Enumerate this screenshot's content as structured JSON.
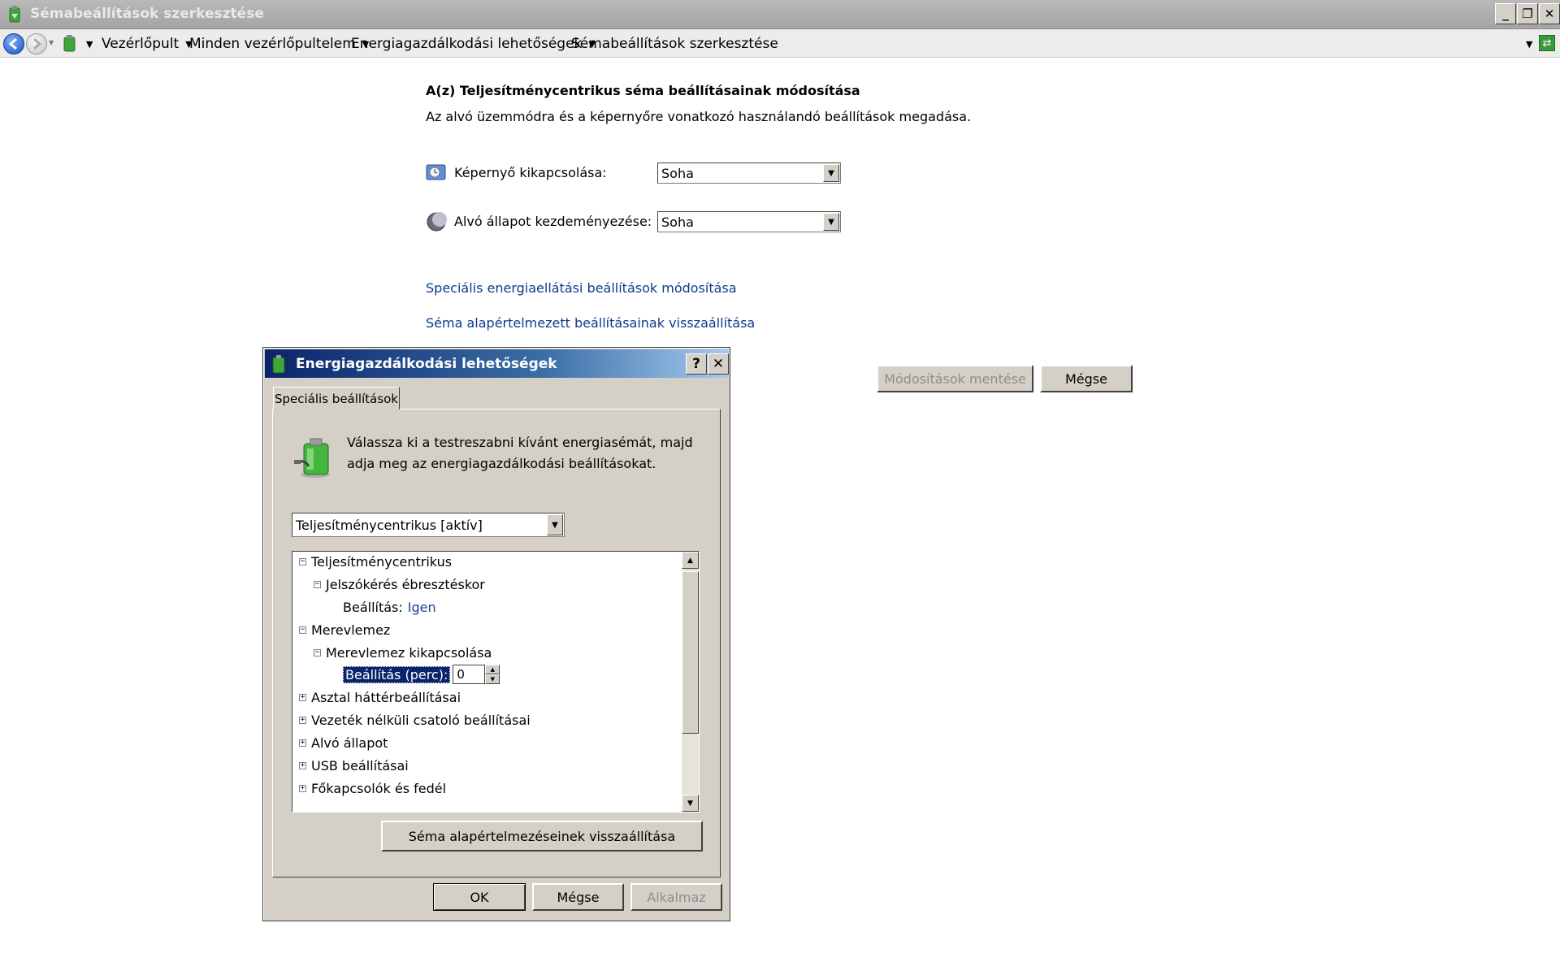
{
  "window": {
    "title": "Sémabeállítások szerkesztése",
    "minimize": "_",
    "restore": "❐",
    "close": "✕"
  },
  "address": {
    "crumbs": [
      "Vezérlőpult",
      "Minden vezérlőpultelem",
      "Energiagazdálkodási lehetőségek",
      "Sémabeállítások szerkesztése"
    ]
  },
  "main": {
    "heading": "A(z) Teljesítménycentrikus séma beállításainak módosítása",
    "subheading": "Az alvó üzemmódra és a képernyőre vonatkozó használandó beállítások megadása.",
    "display_off_label": "Képernyő kikapcsolása:",
    "display_off_value": "Soha",
    "sleep_label": "Alvó állapot kezdeményezése:",
    "sleep_value": "Soha",
    "advanced_link": "Speciális energiaellátási beállítások módosítása",
    "restore_link": "Séma alapértelmezett beállításainak visszaállítása",
    "save_button": "Módosítások mentése",
    "cancel_button": "Mégse"
  },
  "dialog": {
    "title": "Energiagazdálkodási lehetőségek",
    "help": "?",
    "close": "✕",
    "tab": "Speciális beállítások",
    "description": "Válassza ki a testreszabni kívánt energiasémát, majd adja meg az energiagazdálkodási beállításokat.",
    "scheme_value": "Teljesítménycentrikus [aktív]",
    "tree": {
      "n0": "Teljesítménycentrikus",
      "n1": "Jelszókérés ébresztéskor",
      "n2_label": "Beállítás:",
      "n2_value": "Igen",
      "n3": "Merevlemez",
      "n4": "Merevlemez kikapcsolása",
      "n5_label": "Beállítás (perc):",
      "n5_value": "0",
      "n6": "Asztal háttérbeállításai",
      "n7": "Vezeték nélküli csatoló beállításai",
      "n8": "Alvó állapot",
      "n9": "USB beállításai",
      "n10": "Főkapcsolók és fedél"
    },
    "restore_defaults": "Séma alapértelmezéseinek visszaállítása",
    "ok": "OK",
    "cancel": "Mégse",
    "apply": "Alkalmaz"
  }
}
